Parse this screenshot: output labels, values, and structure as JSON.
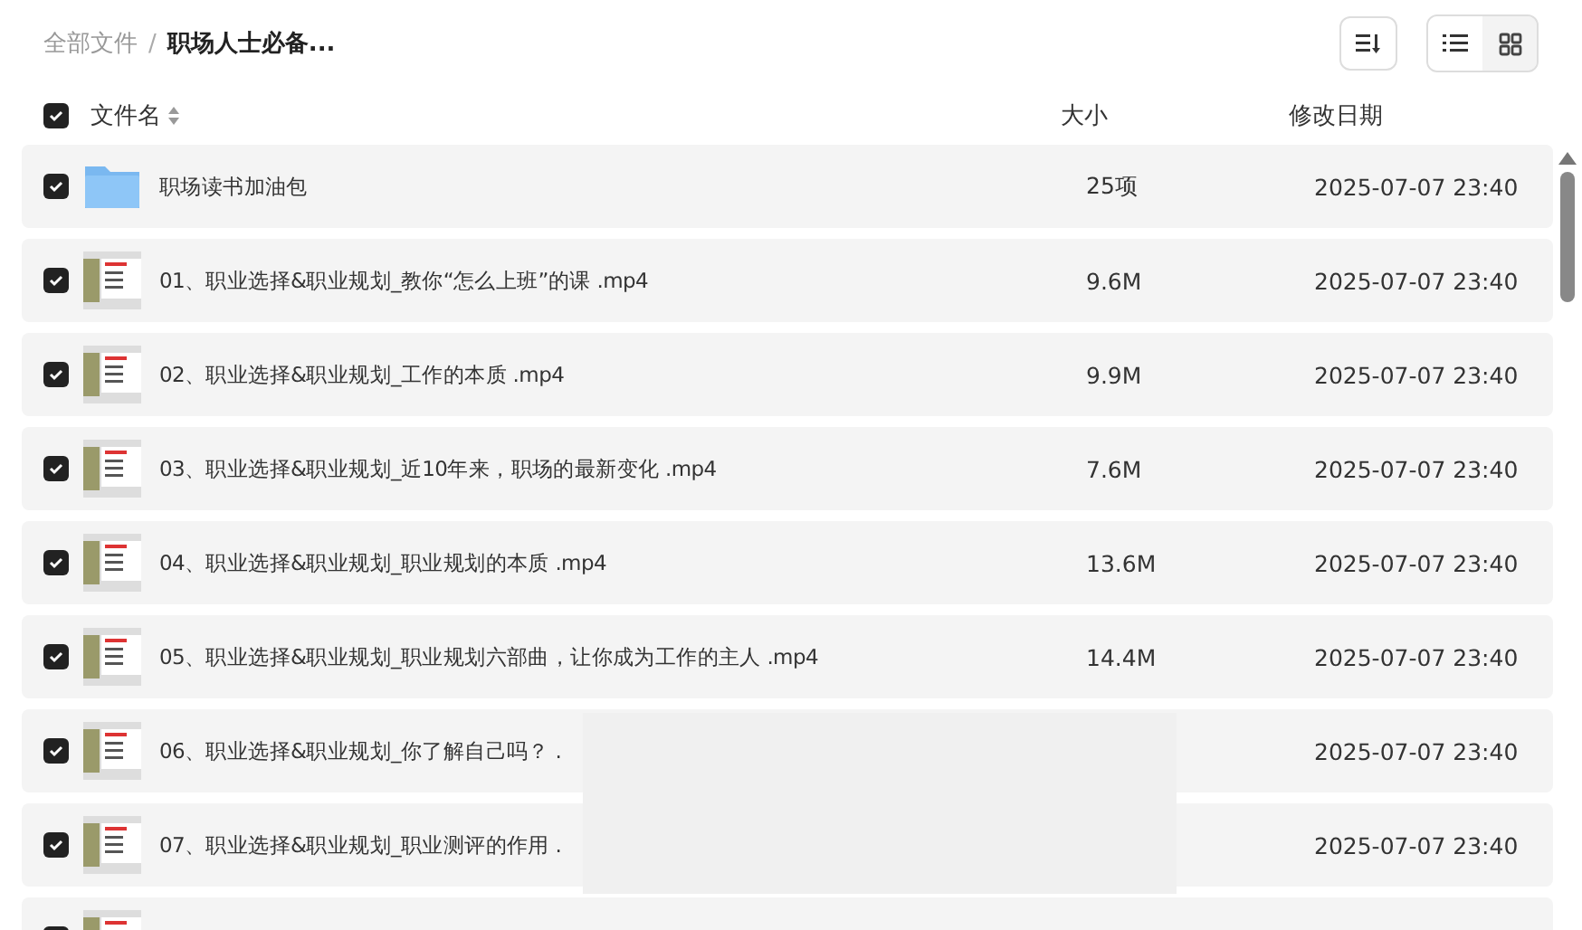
{
  "breadcrumb": {
    "root": "全部文件",
    "separator": "/",
    "current": "职场人士必备..."
  },
  "toolbar": {
    "view_modes": [
      {
        "kind": "list",
        "selected": true
      },
      {
        "kind": "grid",
        "selected": false
      }
    ]
  },
  "table": {
    "select_all": {
      "checked": true
    },
    "columns": [
      "文件名",
      "大小",
      "修改日期"
    ],
    "rows": [
      {
        "kind": "folder",
        "checked": true,
        "name": "职场读书加油包",
        "size": "25项",
        "date": "2025-07-07 23:40"
      },
      {
        "kind": "video",
        "checked": true,
        "name": "01、职业选择&职业规划_教你“怎么上班”的课 .mp4",
        "size": "9.6M",
        "date": "2025-07-07 23:40"
      },
      {
        "kind": "video",
        "checked": true,
        "name": "02、职业选择&职业规划_工作的本质 .mp4",
        "size": "9.9M",
        "date": "2025-07-07 23:40"
      },
      {
        "kind": "video",
        "checked": true,
        "name": "03、职业选择&职业规划_近10年来，职场的最新变化 .mp4",
        "size": "7.6M",
        "date": "2025-07-07 23:40"
      },
      {
        "kind": "video",
        "checked": true,
        "name": "04、职业选择&职业规划_职业规划的本质 .mp4",
        "size": "13.6M",
        "date": "2025-07-07 23:40"
      },
      {
        "kind": "video",
        "checked": true,
        "name": "05、职业选择&职业规划_职业规划六部曲，让你成为工作的主人 .mp4",
        "size": "14.4M",
        "date": "2025-07-07 23:40"
      },
      {
        "kind": "video",
        "checked": true,
        "name": "06、职业选择&职业规划_你了解自己吗？ .",
        "date": "2025-07-07 23:40"
      },
      {
        "kind": "video",
        "checked": true,
        "name": "07、职业选择&职业规划_职业测评的作用 .",
        "date": "2025-07-07 23:40"
      },
      {
        "kind": "video",
        "checked": true
      }
    ]
  }
}
